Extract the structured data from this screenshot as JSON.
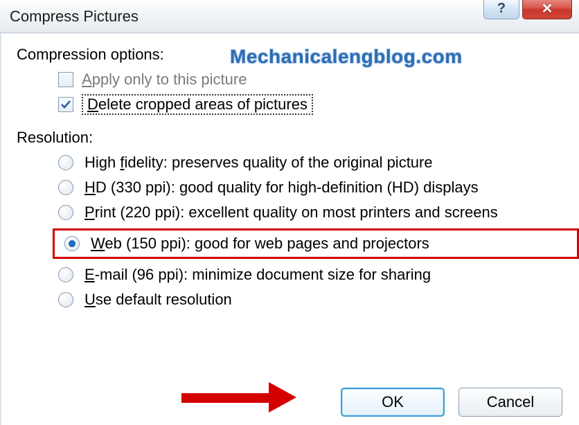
{
  "title": "Compress Pictures",
  "watermark": "Mechanicalengblog.com",
  "compression": {
    "label": "Compression options:",
    "apply_only": {
      "pre": "A",
      "rest": "pply only to this picture"
    },
    "delete_cropped": {
      "pre": "D",
      "rest": "elete cropped areas of pictures"
    }
  },
  "resolution": {
    "label": "Resolution:",
    "items": [
      {
        "pre": "High ",
        "u": "f",
        "rest": "idelity: preserves quality of the original picture"
      },
      {
        "pre": "",
        "u": "H",
        "rest": "D (330 ppi): good quality for high-definition (HD) displays"
      },
      {
        "pre": "",
        "u": "P",
        "rest": "rint (220 ppi): excellent quality on most printers and screens"
      },
      {
        "pre": "",
        "u": "W",
        "rest": "eb (150 ppi): good for web pages and projectors"
      },
      {
        "pre": "",
        "u": "E",
        "rest": "-mail (96 ppi): minimize document size for sharing"
      },
      {
        "pre": "",
        "u": "U",
        "rest": "se default resolution"
      }
    ]
  },
  "buttons": {
    "ok": "OK",
    "cancel": "Cancel"
  },
  "help_glyph": "?",
  "close_glyph": "✕"
}
